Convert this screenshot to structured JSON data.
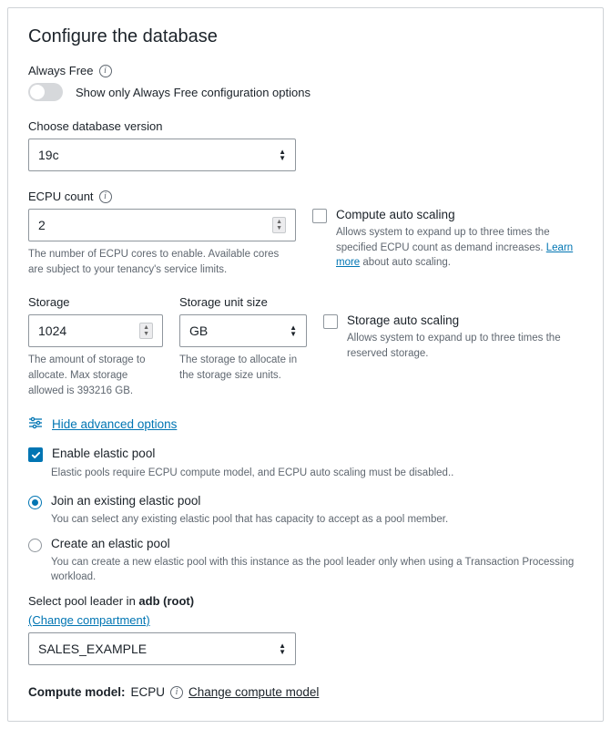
{
  "title": "Configure the database",
  "alwaysFree": {
    "label": "Always Free",
    "toggleDesc": "Show only Always Free configuration options"
  },
  "dbVersion": {
    "label": "Choose database version",
    "value": "19c"
  },
  "ecpu": {
    "label": "ECPU count",
    "value": "2",
    "help": "The number of ECPU cores to enable. Available cores are subject to your tenancy's service limits."
  },
  "computeAutoScaling": {
    "label": "Compute auto scaling",
    "desc_pre": "Allows system to expand up to three times the specified ECPU count as demand increases. ",
    "learnMore": "Learn more",
    "desc_post": " about auto scaling."
  },
  "storage": {
    "label": "Storage",
    "value": "1024",
    "help": "The amount of storage to allocate. Max storage allowed is 393216 GB."
  },
  "storageUnit": {
    "label": "Storage unit size",
    "value": "GB",
    "help": "The storage to allocate in the storage size units."
  },
  "storageAutoScaling": {
    "label": "Storage auto scaling",
    "desc": "Allows system to expand up to three times the reserved storage."
  },
  "advanced": {
    "toggleText": "Hide advanced options"
  },
  "elasticPool": {
    "enableLabel": "Enable elastic pool",
    "enableDesc": "Elastic pools require ECPU compute model, and ECPU auto scaling must be disabled..",
    "joinLabel": "Join an existing elastic pool",
    "joinDesc": "You can select any existing elastic pool that has capacity to accept as a pool member.",
    "createLabel": "Create an elastic pool",
    "createDesc": "You can create a new elastic pool with this instance as the pool leader only when using a Transaction Processing workload."
  },
  "poolLeader": {
    "label_pre": "Select pool leader in ",
    "label_bold": "adb (root)",
    "changeCompartment": "(Change compartment)",
    "value": "SALES_EXAMPLE"
  },
  "computeModel": {
    "label": "Compute model:",
    "value": "ECPU",
    "change": "Change compute model"
  }
}
